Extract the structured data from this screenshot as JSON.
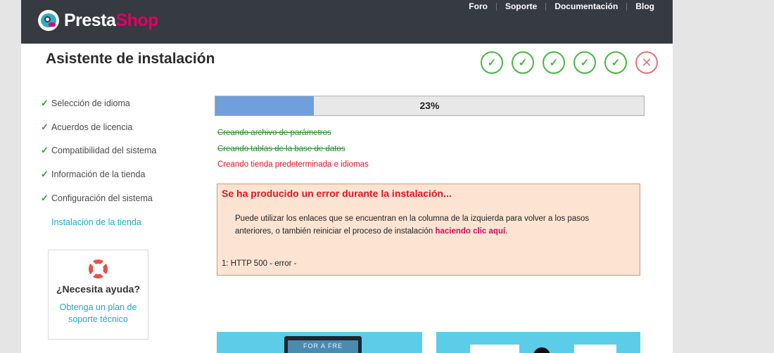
{
  "header": {
    "logo_presta": "Presta",
    "logo_shop": "Shop",
    "nav": [
      "Foro",
      "Soporte",
      "Documentación",
      "Blog"
    ]
  },
  "title": "Asistente de instalación",
  "steps": [
    {
      "state": "done",
      "icon": "check-icon",
      "glyph": "✓"
    },
    {
      "state": "done",
      "icon": "check-icon",
      "glyph": "✓"
    },
    {
      "state": "done",
      "icon": "check-icon",
      "glyph": "✓"
    },
    {
      "state": "done",
      "icon": "check-icon",
      "glyph": "✓"
    },
    {
      "state": "done",
      "icon": "check-icon",
      "glyph": "✓"
    },
    {
      "state": "error",
      "icon": "close-icon",
      "glyph": "✕"
    }
  ],
  "sidebar": {
    "items": [
      {
        "label": "Selección de idioma",
        "done": true
      },
      {
        "label": "Acuerdos de licencia",
        "done": true
      },
      {
        "label": "Compatibilidad del sistema",
        "done": true
      },
      {
        "label": "Información de la tienda",
        "done": true
      },
      {
        "label": "Configuración del sistema",
        "done": true
      },
      {
        "label": "Instalación de la tienda",
        "done": false
      }
    ],
    "check_glyph": "✓"
  },
  "help": {
    "title": "¿Necesita ayuda?",
    "link": "Obtenga un plan de soporte técnico"
  },
  "progress": {
    "value": 0.23,
    "label": "23%"
  },
  "log": [
    {
      "text": "Creando archivo de parámetros",
      "status": "done"
    },
    {
      "text": "Creando tablas de la base de datos",
      "status": "done"
    },
    {
      "text": "Creando tienda predeterminada e idiomas",
      "status": "failed"
    }
  ],
  "error": {
    "title": "Se ha producido un error durante la instalación...",
    "message": "Puede utilizar los enlaces que se encuentran en la columna de la izquierda para volver a los pasos anteriores, o también reiniciar el proceso de instalación ",
    "link": "haciendo clic aquí",
    "message_end": ".",
    "code": "1: HTTP 500 - error -"
  },
  "promo": {
    "screen_text": "FOR A FRE"
  },
  "colors": {
    "header_bg": "#363a41",
    "brand_pink": "#df0067",
    "success_green": "#48b740",
    "error_red": "#e0141e",
    "link_blue": "#22a9c9",
    "progress_fill": "#6f9fdc"
  }
}
